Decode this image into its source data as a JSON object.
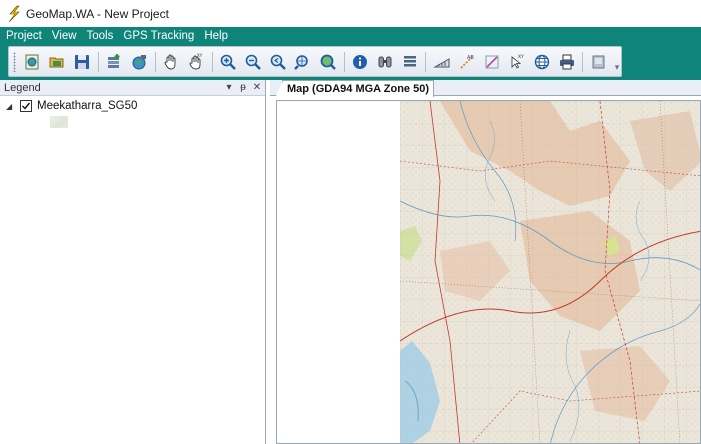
{
  "window": {
    "title": "GeoMap.WA - New Project"
  },
  "menu": {
    "items": [
      "Project",
      "View",
      "Tools",
      "GPS Tracking",
      "Help"
    ]
  },
  "toolbar": {
    "buttons": [
      "new-project-icon",
      "open-project-icon",
      "save-project-icon",
      "add-layer-icon",
      "add-gps-layer-icon",
      "pan-icon",
      "xy-pan-icon",
      "zoom-in-icon",
      "zoom-out-icon",
      "zoom-previous-icon",
      "zoom-extent-icon",
      "zoom-layer-icon",
      "info-icon",
      "find-icon",
      "layer-list-icon",
      "measure-icon",
      "ab-measure-icon",
      "draw-line-icon",
      "xy-point-icon",
      "globe-icon",
      "print-icon",
      "export-icon"
    ]
  },
  "legend": {
    "title": "Legend",
    "pin_glyph": "▾ ᵽ ✕",
    "layers": [
      {
        "name": "Meekatharra_SG50",
        "checked": true,
        "expanded": true
      }
    ]
  },
  "map": {
    "tab_label": "Map (GDA94 MGA Zone 50)"
  },
  "colors": {
    "menu_bg": "#0e8578",
    "map_base": "#e9e3d5",
    "map_highland": "#e7c6aa",
    "map_water": "#9cc8de",
    "map_roads": "#c23b2b"
  }
}
